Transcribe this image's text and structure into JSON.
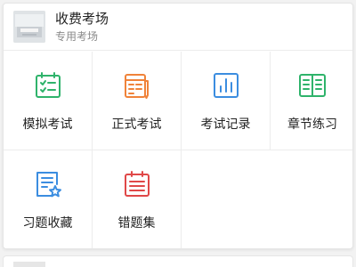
{
  "header": {
    "title": "收费考场",
    "subtitle": "专用考场"
  },
  "grid": {
    "items": [
      {
        "label": "模拟考试",
        "icon": "checklist-icon",
        "color": "#2fb36b"
      },
      {
        "label": "正式考试",
        "icon": "exam-paper-icon",
        "color": "#f0833a"
      },
      {
        "label": "考试记录",
        "icon": "bar-chart-icon",
        "color": "#3b8de0"
      },
      {
        "label": "章节练习",
        "icon": "open-book-icon",
        "color": "#2fb36b"
      },
      {
        "label": "习题收藏",
        "icon": "star-document-icon",
        "color": "#3b8de0"
      },
      {
        "label": "错题集",
        "icon": "wrong-book-icon",
        "color": "#e04848"
      }
    ]
  }
}
